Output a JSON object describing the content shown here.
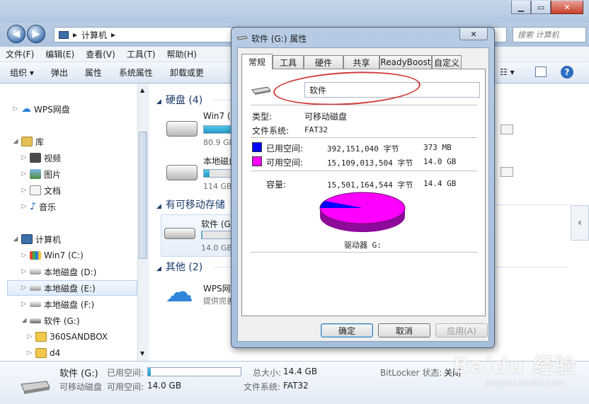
{
  "address": {
    "path": "计算机",
    "search_placeholder": "搜索 计算机"
  },
  "menu": [
    "文件(F)",
    "编辑(E)",
    "查看(V)",
    "工具(T)",
    "帮助(H)"
  ],
  "toolbar": {
    "organize": "组织",
    "eject": "弹出",
    "properties": "属性",
    "system_properties": "系统属性",
    "uninstall": "卸载或更"
  },
  "nav": {
    "wps": "WPS网盘",
    "library": "库",
    "video": "视频",
    "pictures": "图片",
    "documents": "文档",
    "music": "音乐",
    "computer": "计算机",
    "win7": "Win7 (C:)",
    "disk_d": "本地磁盘 (D:)",
    "disk_e": "本地磁盘 (E:)",
    "disk_f": "本地磁盘 (F:)",
    "soft_g": "软件 (G:)",
    "folder1": "360SANDBOX",
    "folder2": "d4"
  },
  "content": {
    "group_hdd": "硬盘 (4)",
    "group_removable": "有可移动存储",
    "group_other": "其他 (2)",
    "tile1_name": "Win7 (C",
    "tile1_sub": "80.9 GB",
    "tile2_name": "本地磁盘",
    "tile2_sub": "114 GB",
    "tile3_name": "软件 (G",
    "tile3_sub": "14.0 GB",
    "tile4_name": "WPS网盘",
    "tile4_sub": "提供完善"
  },
  "details": {
    "name": "软件 (G:)",
    "type": "可移动磁盘",
    "used_label": "已用空间:",
    "free_label": "可用空间:",
    "free_value": "14.0 GB",
    "total_label": "总大小:",
    "total_value": "14.4 GB",
    "fs_label": "文件系统:",
    "fs_value": "FAT32",
    "bitlocker_label": "BitLocker 状态:",
    "bitlocker_value": "关闭"
  },
  "dialog": {
    "title": "软件 (G:) 属性",
    "tabs": [
      "常规",
      "工具",
      "硬件",
      "共享",
      "ReadyBoost",
      "自定义"
    ],
    "volume_name": "软件",
    "type_label": "类型:",
    "type_value": "可移动磁盘",
    "fs_label": "文件系统:",
    "fs_value": "FAT32",
    "used_label": "已用空间:",
    "used_bytes": "392,151,040 字节",
    "used_human": "373 MB",
    "free_label": "可用空间:",
    "free_bytes": "15,109,013,504 字节",
    "free_human": "14.0 GB",
    "cap_label": "容量:",
    "cap_bytes": "15,501,164,544 字节",
    "cap_human": "14.4 GB",
    "drive_label": "驱动器 G:",
    "ok": "确定",
    "cancel": "取消",
    "apply": "应用(A)"
  },
  "colors": {
    "used": "#0000ff",
    "free": "#ff00ff"
  },
  "watermark": {
    "brand": "Baidu 经验",
    "url": "jingyan.baidu.com"
  }
}
